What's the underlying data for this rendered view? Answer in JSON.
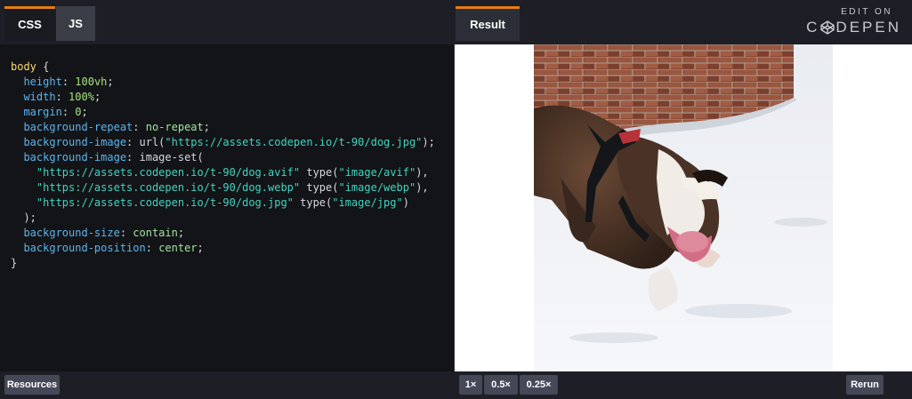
{
  "tabs": {
    "css": "CSS",
    "js": "JS",
    "result": "Result"
  },
  "branding": {
    "edit_on": "EDIT ON",
    "codepen_before": "C",
    "codepen_after": "DEPEN"
  },
  "code": {
    "selector": "body",
    "lines": [
      {
        "prop": "height",
        "val": "100vh"
      },
      {
        "prop": "width",
        "val": "100%"
      },
      {
        "prop": "margin",
        "val": "0"
      },
      {
        "prop": "background-repeat",
        "val": "no-repeat"
      },
      {
        "prop": "background-image",
        "fn": "url(",
        "str": "\"https://assets.codepen.io/t-90/dog.jpg\"",
        "end": ");"
      },
      {
        "prop": "background-image",
        "fn": "image-set("
      },
      {
        "str": "\"https://assets.codepen.io/t-90/dog.avif\"",
        "type": "\"image/avif\"",
        "end": "),"
      },
      {
        "str": "\"https://assets.codepen.io/t-90/dog.webp\"",
        "type": "\"image/webp\"",
        "end": "),"
      },
      {
        "str": "\"https://assets.codepen.io/t-90/dog.jpg\"",
        "type": "\"image/jpg\"",
        "end": ")"
      },
      {
        "prop": "background-size",
        "val": "contain"
      },
      {
        "prop": "background-position",
        "val": "center"
      }
    ]
  },
  "bottom": {
    "resources": "Resources",
    "zoom_1": "1×",
    "zoom_05": "0.5×",
    "zoom_025": "0.25×",
    "rerun": "Rerun"
  },
  "colors": {
    "accent": "#e57e14",
    "bar": "#1e1f26",
    "editor_bg": "#131417"
  }
}
